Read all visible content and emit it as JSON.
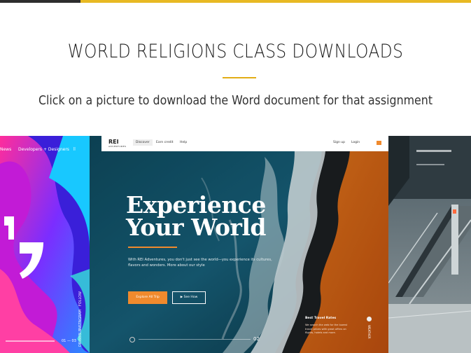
{
  "header": {
    "title": "WORLD RELIGIONS CLASS DOWNLOADS",
    "subtitle": "Click on a picture to download the Word document for that assignment"
  },
  "colors": {
    "accent": "#e2ad16",
    "hero_orange": "#f08a2d"
  },
  "gallery": {
    "left_card": {
      "nav": [
        "News",
        "Developers",
        "+ Designers"
      ],
      "vertical_labels": [
        "FOLLOW",
        "INSTAGRAM",
        "DRIBBBLE"
      ],
      "page_counter": "01 — 03"
    },
    "middle_card": {
      "logo": "REI",
      "logo_sub": "ADVENTURES",
      "nav": [
        "Discover",
        "Earn credit",
        "Help"
      ],
      "nav_right": [
        "Sign up",
        "Login"
      ],
      "hero_title_line1": "Experience",
      "hero_title_line2": "Your World",
      "hero_text": "With REI Adventures, you don't just see the world—you experience its cultures, flavors and wonders. More about our style",
      "button_primary": "Explore All Trip",
      "button_secondary": "▶  See How",
      "slide_number": "02",
      "rates_title": "Best Travel Rates",
      "rates_text": "We search the web for the lowest travel prices with great offers on flights, hotels and more.",
      "rates_vertical": "WEATHER"
    },
    "right_card": {
      "description_icon": "escalator-photo"
    }
  }
}
